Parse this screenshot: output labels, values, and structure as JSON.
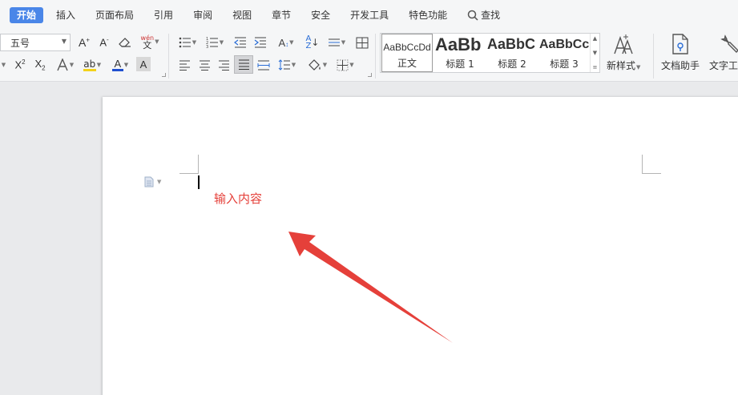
{
  "tabs": [
    {
      "label": "开始",
      "active": true
    },
    {
      "label": "插入"
    },
    {
      "label": "页面布局"
    },
    {
      "label": "引用"
    },
    {
      "label": "审阅"
    },
    {
      "label": "视图"
    },
    {
      "label": "章节"
    },
    {
      "label": "安全"
    },
    {
      "label": "开发工具"
    },
    {
      "label": "特色功能"
    }
  ],
  "search": {
    "label": "查找",
    "icon": "search-icon"
  },
  "ribbon": {
    "font_size": "五号",
    "phonetic_label": "wén",
    "styles": [
      {
        "preview": "AaBbCcDd",
        "label": "正文"
      },
      {
        "preview": "AaBb",
        "label": "标题 1"
      },
      {
        "preview": "AaBbC",
        "label": "标题 2"
      },
      {
        "preview": "AaBbCc",
        "label": "标题 3"
      }
    ],
    "new_style_label": "新样式",
    "doc_assistant_label": "文档助手",
    "text_tools_label": "文字工具"
  },
  "document": {
    "content": "输入内容"
  },
  "colors": {
    "accent": "#4a86e8",
    "annotation_red": "#e5403a",
    "highlight_yellow": "#f3d21a",
    "font_color_red": "#e02020"
  }
}
